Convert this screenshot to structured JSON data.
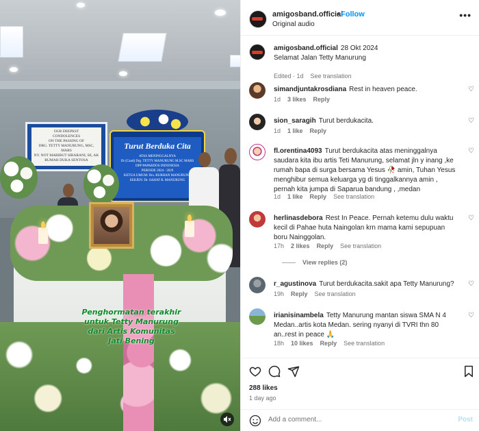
{
  "media": {
    "overlay_lines": [
      "Penghormatan terakhir",
      "untuk Tetty Manurung",
      "dari Artis Komunitas",
      "Jati Bening"
    ],
    "banner_text": [
      "OUR DEEPEST",
      "CONDOLENCES",
      "ON THE PASSING OF",
      "DRG. TETTY MANURUNG, MSC,",
      "MARS",
      "NY. NOT MARIBUT SIBARANI, SE, AK",
      "RUMAH DUKA SENTOSA"
    ],
    "wreath_title": "Turut Berduka Cita",
    "wreath_lines": [
      "ATAS MENINGGALNYA",
      "Dr (Cand) Drg. TETTY MANURUNG M.SC MARS",
      "DPP PAPARDOS INDONESIA",
      "PERIODE 2024 - 2029",
      "KETUA UMUM: Drs. BURHAN MANURUNG",
      "SEKJEN: Dr. SAHAT R. MANURUNG"
    ],
    "mute_icon": "speaker-muted-icon"
  },
  "post": {
    "username": "amigosband.official",
    "follow_label": "Follow",
    "audio": "Original audio",
    "more_icon": "more-horizontal-icon",
    "caption": {
      "username": "amigosband.official",
      "date": "28 Okt 2024",
      "text": "Selamat Jalan Tetty Manurung",
      "edited": "Edited · 1d",
      "see_translation": "See translation"
    },
    "likes": "288 likes",
    "posted_ago": "1 day ago"
  },
  "comments": [
    {
      "username": "simandjuntakrosdiana",
      "text": "Rest in heaven peace.",
      "age": "1d",
      "likes": "3 likes",
      "reply": "Reply",
      "translate": ""
    },
    {
      "username": "sion_saragih",
      "text": "Turut berdukacita.",
      "age": "1d",
      "likes": "1 like",
      "reply": "Reply",
      "translate": ""
    },
    {
      "username": "fl.orentina4093",
      "text": "Turut berdukacita atas meninggalnya saudara kita ibu artis Teti Manurung, selamat jln y inang ,ke rumah bapa di surga bersama Yesus 🥀 amin, Tuhan Yesus menghibur semua keluarga yg di tinggalkannya amin , pernah kita jumpa di Saparua bandung , ,medan",
      "age": "1d",
      "likes": "1 like",
      "reply": "Reply",
      "translate": "See translation"
    },
    {
      "username": "herlinasdebora",
      "text": "Rest In Peace. Pernah ketemu dulu waktu kecil di Pahae huta Naingolan krn mama kami sepupuan boru Nainggolan.",
      "age": "17h",
      "likes": "2 likes",
      "reply": "Reply",
      "translate": "See translation",
      "view_replies": "View replies (2)"
    },
    {
      "username": "r_agustinova",
      "text": "Turut berdukacita.sakit apa Tetty Manurung?",
      "age": "19h",
      "likes": "",
      "reply": "Reply",
      "translate": "See translation"
    },
    {
      "username": "irianisinambela",
      "text": "Tetty Manurung mantan siswa SMA N 4 Medan..artis kota Medan. sering nyanyi di TVRI thn 80 an..rest in peace 🙏",
      "age": "18h",
      "likes": "10 likes",
      "reply": "Reply",
      "translate": "See translation"
    }
  ],
  "composer": {
    "placeholder": "Add a comment...",
    "post_label": "Post",
    "emoji_icon": "emoji-smile-icon"
  },
  "colors": {
    "link_blue": "#0095f6",
    "muted": "#737373",
    "overlay_green": "#0f8a2d"
  }
}
